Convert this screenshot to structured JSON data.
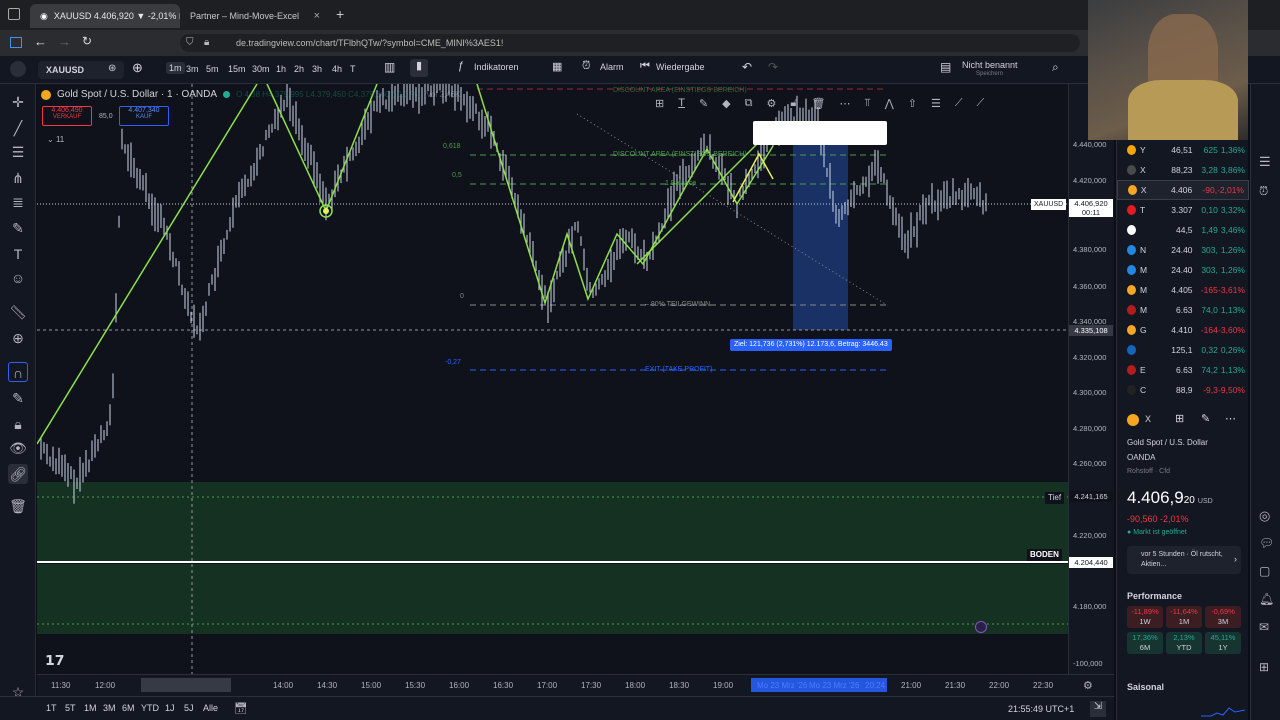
{
  "browser": {
    "tabs": [
      {
        "label": "XAUUSD 4.406,920 ▼ -2,01% ⊡",
        "active": true
      },
      {
        "label": "Partner – Mind-Move-Excel",
        "active": false
      }
    ],
    "url": "de.tradingview.com/chart/TFlbhQTw/?symbol=CME_MINI%3AES1!"
  },
  "toolbar": {
    "symbol": "XAUUSD",
    "intervals": [
      "1m",
      "3m",
      "5m",
      "15m",
      "30m",
      "1h",
      "2h",
      "3h",
      "4h",
      "T"
    ],
    "active_interval": "1m",
    "indicators": "Indikatoren",
    "alarm": "Alarm",
    "replay": "Wiedergabe",
    "layout_name": "Nicht benannt",
    "layout_sub": "Speichern"
  },
  "chart": {
    "legend_title": "Gold Spot / U.S. Dollar · 1 · OANDA",
    "ohlc": "O 4.38 H4.379,995 L4.379,450 C4.379,660 (-0,0 %)",
    "volume": "Vol 2,46K",
    "sell_price": "4.406,490",
    "sell_label": "VERKAUF",
    "spread": "85,0",
    "buy_price": "4.407,340",
    "buy_label": "KAUF",
    "indicator_count": "11",
    "fib_labels": {
      "discount_top": "DISCOUNT AREA (EINSTIEGS BEREICH)",
      "discount": "DISCOUNT AREA (EINSTIEGS BEREICH)",
      "balance": "1 Balance",
      "teilgewinn": "– 80% TEILGEWINN",
      "exit": "EXIT (TAKE PROFIT)",
      "lvl_0618": "0,618",
      "lvl_05": "0,5",
      "lvl_0": "0",
      "lvl_m027": "-0,27"
    },
    "ziel_label": "Ziel: 121,736 (2,731%) 12.173,6, Betrag: 3446.43",
    "tief_label": "Tief",
    "boden_label": "BODEN",
    "symbol_tag": "XAUUSD",
    "current_price": "4.406,920",
    "countdown": "00:11",
    "crosshair_price": "4.335,108",
    "tief_price": "4.241,165",
    "boden_price": "4.204,440"
  },
  "price_axis": [
    "4.440,000",
    "4.420,000",
    "4.380,000",
    "4.360,000",
    "4.340,000",
    "4.320,000",
    "4.300,000",
    "4.280,000",
    "4.260,000",
    "4.220,000",
    "4.180,000",
    "-100,000"
  ],
  "time_axis": [
    "11:30",
    "12:00",
    "Mo 23 Mrz '26",
    "12:59",
    "14:00",
    "14:30",
    "15:00",
    "15:30",
    "16:00",
    "16:30",
    "17:00",
    "17:30",
    "18:00",
    "18:30",
    "19:00",
    "Mo 23 Mrz '26",
    "Mo 23 Mrz '26",
    "20:24",
    "21:00",
    "21:30",
    "22:00",
    "22:30"
  ],
  "ranges": [
    "1T",
    "5T",
    "1M",
    "3M",
    "6M",
    "YTD",
    "1J",
    "5J",
    "Alle"
  ],
  "clock": "21:55:49 UTC+1",
  "watchlist": [
    {
      "sym": "Y",
      "last": "46,51",
      "chg": "625",
      "chp": "1,36%",
      "color": "#f7a600",
      "dir": "up"
    },
    {
      "sym": "X",
      "last": "88,23",
      "chg": "3,28",
      "chp": "3,86%",
      "color": "#4a4a4a",
      "dir": "up"
    },
    {
      "sym": "X",
      "last": "4.406",
      "chg": "-90,",
      "chp": "-2,01%",
      "color": "#f5a623",
      "dir": "down"
    },
    {
      "sym": "T",
      "last": "3.307",
      "chg": "0,10",
      "chp": "3,32%",
      "color": "#e31b23",
      "dir": "up"
    },
    {
      "sym": "",
      "last": "44,5",
      "chg": "1,49",
      "chp": "3,46%",
      "color": "#ffffff",
      "dir": "up"
    },
    {
      "sym": "N",
      "last": "24.40",
      "chg": "303,",
      "chp": "1,26%",
      "color": "#1e88e5",
      "dir": "up"
    },
    {
      "sym": "M",
      "last": "24.40",
      "chg": "303,",
      "chp": "1,26%",
      "color": "#1e88e5",
      "dir": "up"
    },
    {
      "sym": "M",
      "last": "4.405",
      "chg": "-165",
      "chp": "-3,61%",
      "color": "#f5a623",
      "dir": "down"
    },
    {
      "sym": "M",
      "last": "6.63",
      "chg": "74,0",
      "chp": "1,13%",
      "color": "#b71c1c",
      "dir": "up"
    },
    {
      "sym": "G",
      "last": "4.410",
      "chg": "-164",
      "chp": "-3,60%",
      "color": "#f5a623",
      "dir": "down"
    },
    {
      "sym": "",
      "last": "125,1",
      "chg": "0,32",
      "chp": "0,26%",
      "color": "#1565c0",
      "dir": "up"
    },
    {
      "sym": "E",
      "last": "6.63",
      "chg": "74,2",
      "chp": "1,13%",
      "color": "#b71c1c",
      "dir": "up"
    },
    {
      "sym": "C",
      "last": "88,9",
      "chg": "-9,3",
      "chp": "-9,50%",
      "color": "#222222",
      "dir": "down"
    }
  ],
  "details": {
    "header_sym": "X",
    "name": "Gold Spot / U.S. Dollar",
    "exchange": "OANDA",
    "type": "Rohstoff · Cfd",
    "price_main": "4.406,9",
    "price_tail": "20",
    "currency": "USD",
    "change": "-90,560 -2,01%",
    "market_status": "Markt ist geöffnet",
    "news": "vor 5 Stunden · Öl rutscht, Aktien...",
    "performance_title": "Performance",
    "perf": [
      {
        "value": "-11,89%",
        "label": "1W",
        "dir": "down"
      },
      {
        "value": "-11,64%",
        "label": "1M",
        "dir": "down"
      },
      {
        "value": "-0,69%",
        "label": "3M",
        "dir": "down"
      },
      {
        "value": "17,36%",
        "label": "6M",
        "dir": "up"
      },
      {
        "value": "2,13%",
        "label": "YTD",
        "dir": "up"
      },
      {
        "value": "45,11%",
        "label": "1Y",
        "dir": "up"
      }
    ],
    "seasonal_title": "Saisonal"
  },
  "colors": {
    "bg": "#0f121a",
    "candles": "#c9d3e6",
    "zigzag": "#8de04a",
    "fib": "#4c9a4c",
    "boden_zone": "#163522",
    "highlight": "#1e3f86",
    "label_blue": "#2962ff"
  }
}
